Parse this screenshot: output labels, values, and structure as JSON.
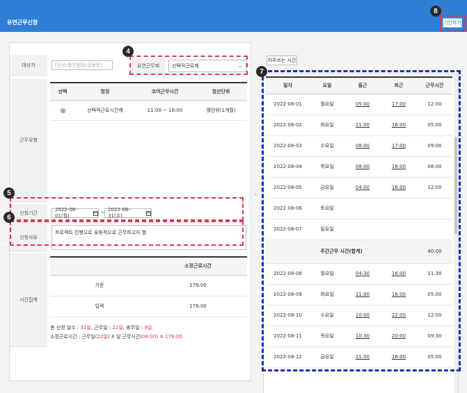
{
  "header": {
    "title": "유연근무신청",
    "submit_label": "기안하기"
  },
  "form": {
    "target_label": "대상자",
    "target_placeholder": "[인사/총무팀원/김동은]",
    "flex_type_label": "유연근무제",
    "flex_type_value": "선택적근로제",
    "work_type_label": "근무유형",
    "work_type_table": {
      "headers": [
        "선택",
        "명칭",
        "코어근무시간",
        "정산단위"
      ],
      "rows": [
        {
          "name": "선택적근로시간제",
          "core": "11:00 ~ 16:00",
          "unit": "월단위(1개월)"
        }
      ]
    },
    "period_label": "신청기간",
    "period_start": "2022-08-01(월)",
    "period_sep": "~",
    "period_end": "2022-08-31(수)",
    "reason_label": "신청사유",
    "reason_value": "프로젝트 진행으로 유동적으로 근무하고자 함",
    "time_summary_label": "시간집계",
    "time_summary_table": {
      "header": "소정근로시간",
      "rows": [
        {
          "label": "기준",
          "value": "176:00"
        },
        {
          "label": "입력",
          "value": "176:00"
        }
      ]
    },
    "summary_line1": {
      "prefix": "총 신청 일수 : ",
      "total": "31일",
      "sep1": ", 근무일 : ",
      "work": "22일",
      "sep2": ", 휴무일 : ",
      "off": "9일"
    },
    "summary_line2": {
      "prefix": "소정근로시간 : 근무일(",
      "days": "22일",
      "mid": ") X 일 근무시간(",
      "hours": "08:00",
      "suffix": ") = ",
      "total": "176:00"
    }
  },
  "side": {
    "frequent_time_button": "자주쓰는 시간",
    "schedule_headers": [
      "일자",
      "요일",
      "출근",
      "퇴근",
      "근무시간"
    ],
    "rows": [
      {
        "date": "2022-08-01",
        "day": "월요일",
        "in": "05:00",
        "out": "17:00",
        "hours": "12:00",
        "holiday": false
      },
      {
        "date": "2022-08-02",
        "day": "화요일",
        "in": "11:00",
        "out": "16:00",
        "hours": "05:00",
        "holiday": false
      },
      {
        "date": "2022-08-03",
        "day": "수요일",
        "in": "08:00",
        "out": "17:00",
        "hours": "09:00",
        "holiday": false
      },
      {
        "date": "2022-08-04",
        "day": "목요일",
        "in": "08:00",
        "out": "16:00",
        "hours": "08:00",
        "holiday": false
      },
      {
        "date": "2022-08-05",
        "day": "금요일",
        "in": "04:00",
        "out": "16:00",
        "hours": "12:00",
        "holiday": false
      },
      {
        "date": "2022-08-06",
        "day": "토요일",
        "in": "",
        "out": "",
        "hours": "",
        "holiday": true
      },
      {
        "date": "2022-08-07",
        "day": "일요일",
        "in": "",
        "out": "",
        "hours": "",
        "holiday": true
      }
    ],
    "weekly_total_label": "주간근무 시간(합계)",
    "weekly_total_value": "40:00",
    "rows2": [
      {
        "date": "2022-08-08",
        "day": "월요일",
        "in": "04:30",
        "out": "16:00",
        "hours": "11:30"
      },
      {
        "date": "2022-08-09",
        "day": "화요일",
        "in": "11:00",
        "out": "16:00",
        "hours": "05:00"
      },
      {
        "date": "2022-08-10",
        "day": "수요일",
        "in": "10:00",
        "out": "22:00",
        "hours": "12:00"
      },
      {
        "date": "2022-08-11",
        "day": "목요일",
        "in": "10:30",
        "out": "20:00",
        "hours": "09:30"
      },
      {
        "date": "2022-08-12",
        "day": "금요일",
        "in": "11:00",
        "out": "16:00",
        "hours": "05:00"
      }
    ]
  },
  "markers": [
    "4",
    "5",
    "6",
    "7",
    "8"
  ],
  "colors": {
    "header_blue": "#2f7fd6",
    "highlight_red": "#e0344a",
    "highlight_blue": "#1a2fb8"
  }
}
